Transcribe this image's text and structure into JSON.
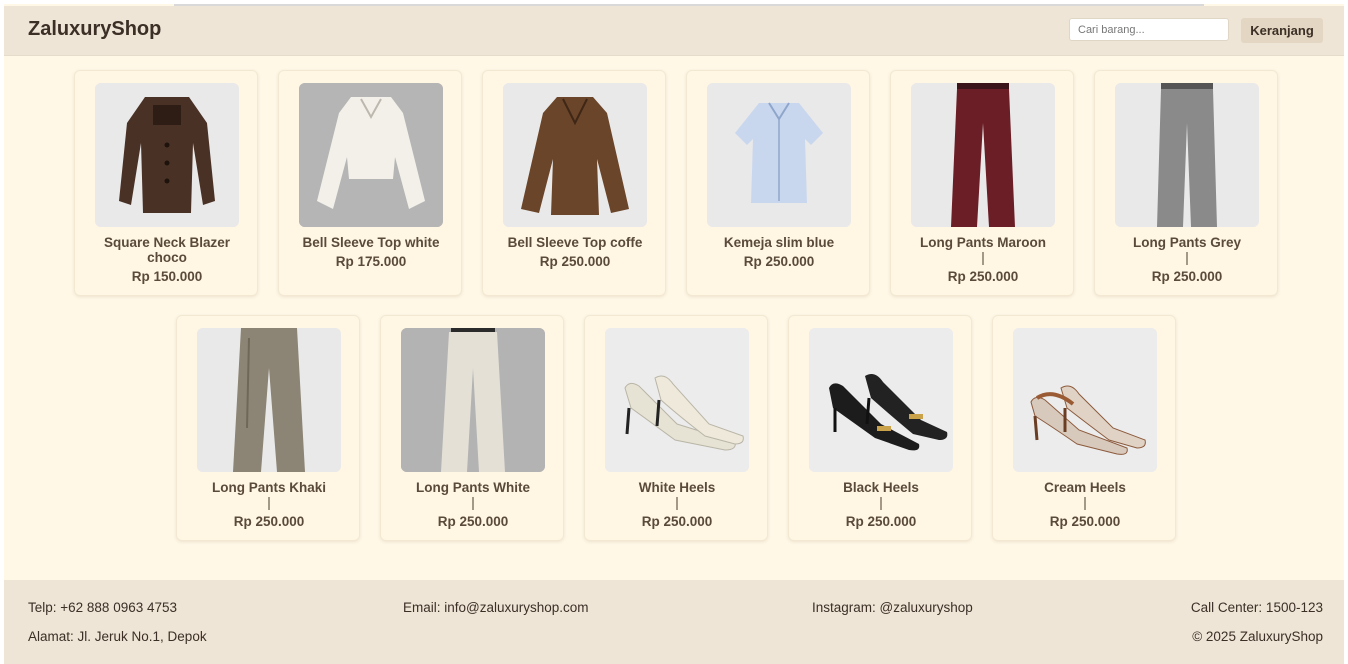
{
  "header": {
    "logo": "ZaluxuryShop",
    "search_placeholder": "Cari barang...",
    "cart_label": "Keranjang"
  },
  "products": [
    {
      "name": "Square Neck Blazer choco",
      "price": "Rp 150.000",
      "separator": "",
      "image": "blazer-choco-icon"
    },
    {
      "name": "Bell Sleeve Top white",
      "price": "Rp 175.000",
      "separator": "",
      "image": "lace-top-white-icon"
    },
    {
      "name": "Bell Sleeve Top coffe",
      "price": "Rp 250.000",
      "separator": "",
      "image": "top-coffee-icon"
    },
    {
      "name": "Kemeja slim blue",
      "price": "Rp 250.000",
      "separator": "",
      "image": "shirt-blue-icon"
    },
    {
      "name": "Long Pants Maroon",
      "price": "Rp 250.000",
      "separator": "|",
      "image": "pants-maroon-icon"
    },
    {
      "name": "Long Pants Grey",
      "price": "Rp 250.000",
      "separator": "|",
      "image": "pants-grey-icon"
    },
    {
      "name": "Long Pants Khaki",
      "price": "Rp 250.000",
      "separator": "|",
      "image": "pants-khaki-icon"
    },
    {
      "name": "Long Pants White",
      "price": "Rp 250.000",
      "separator": "|",
      "image": "pants-white-icon"
    },
    {
      "name": "White Heels",
      "price": "Rp 250.000",
      "separator": "|",
      "image": "heels-white-icon"
    },
    {
      "name": "Black Heels",
      "price": "Rp 250.000",
      "separator": "|",
      "image": "heels-black-icon"
    },
    {
      "name": "Cream Heels",
      "price": "Rp 250.000",
      "separator": "|",
      "image": "heels-cream-icon"
    }
  ],
  "footer": {
    "phone": "Telp: +62 888 0963 4753",
    "address": "Alamat: Jl. Jeruk No.1, Depok",
    "email": "Email: info@zaluxuryshop.com",
    "instagram": "Instagram: @zaluxuryshop",
    "call_center": "Call Center: 1500-123",
    "copyright": "© 2025 ZaluxuryShop"
  },
  "colors": {
    "page_bg": "#fff8e7",
    "header_bg": "#efe5d6",
    "card_bg": "#fff6e4",
    "text": "#5a4a3a",
    "button_bg": "#e3d6c2"
  }
}
